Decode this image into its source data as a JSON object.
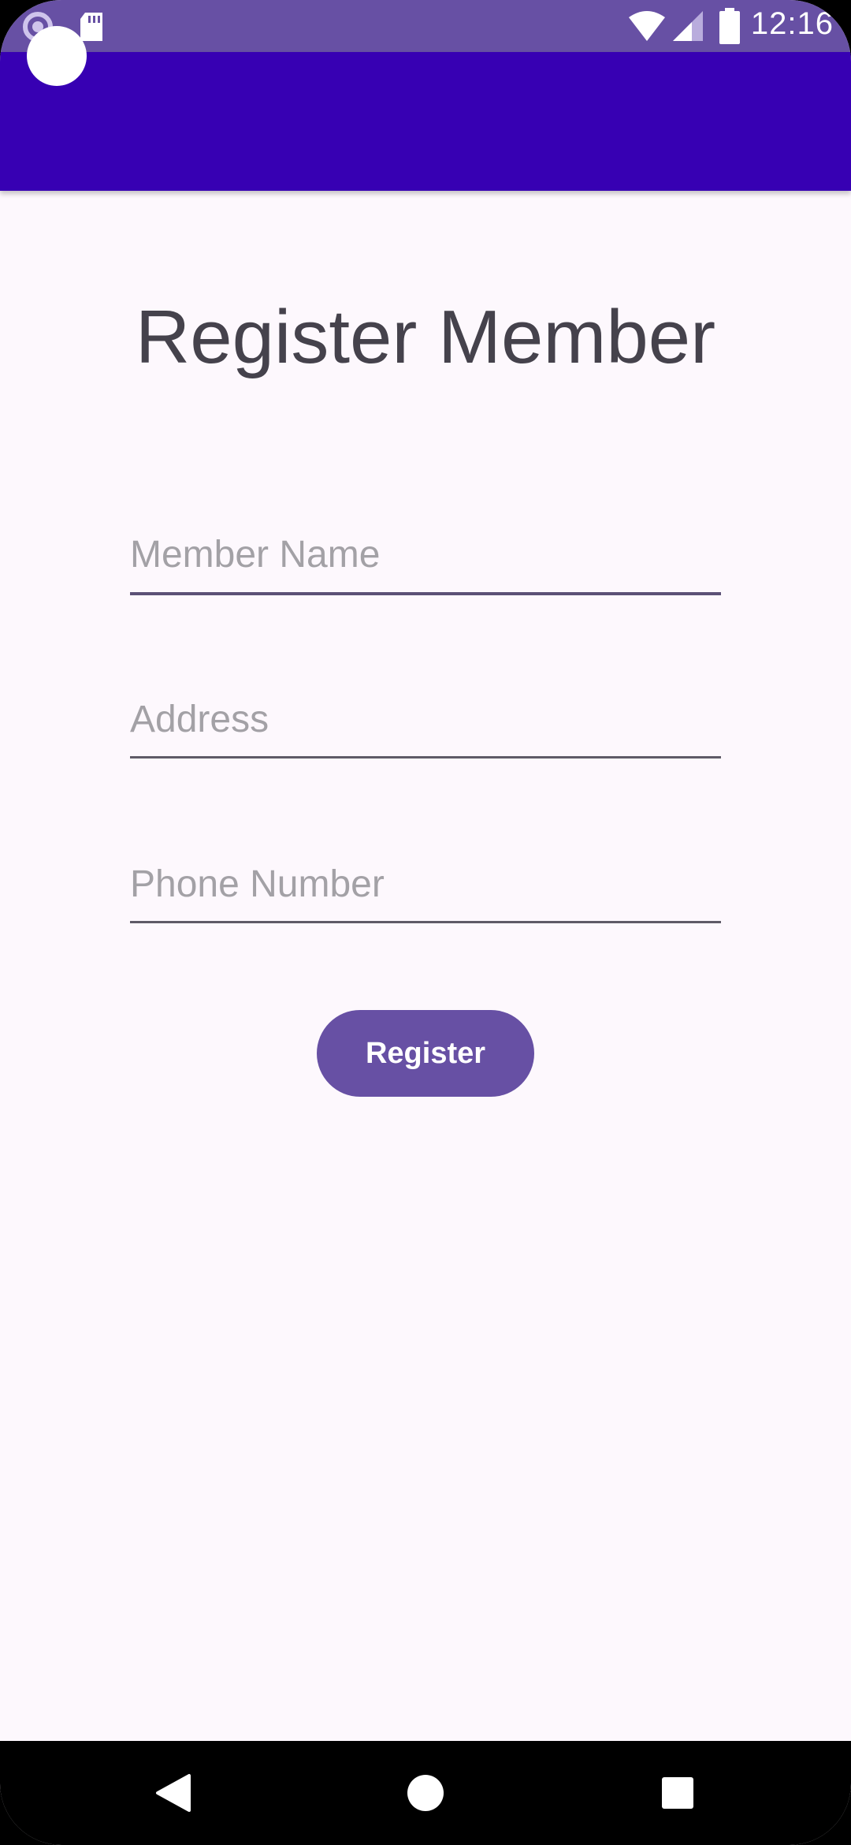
{
  "status_bar": {
    "time": "12:16",
    "icons": [
      "sync-icon",
      "sd-card-icon",
      "wifi-icon",
      "signal-icon",
      "battery-icon"
    ]
  },
  "app_bar": {
    "color": "#3700b3",
    "status_color": "#6750a4"
  },
  "page": {
    "title": "Register Member"
  },
  "form": {
    "member_name": {
      "placeholder": "Member Name",
      "value": ""
    },
    "address": {
      "placeholder": "Address",
      "value": ""
    },
    "phone_number": {
      "placeholder": "Phone Number",
      "value": ""
    },
    "register_label": "Register"
  },
  "nav_bar": {
    "icons": [
      "back-icon",
      "home-icon",
      "recents-icon"
    ]
  },
  "colors": {
    "accent": "#6750a4",
    "background": "#fdf8fd",
    "title_text": "#45424c"
  }
}
